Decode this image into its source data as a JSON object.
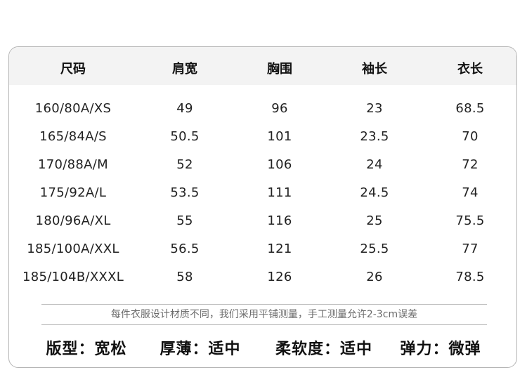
{
  "table": {
    "headers": [
      "尺码",
      "肩宽",
      "胸围",
      "袖长",
      "衣长"
    ],
    "rows": [
      [
        "160/80A/XS",
        "49",
        "96",
        "23",
        "68.5"
      ],
      [
        "165/84A/S",
        "50.5",
        "101",
        "23.5",
        "70"
      ],
      [
        "170/88A/M",
        "52",
        "106",
        "24",
        "72"
      ],
      [
        "175/92A/L",
        "53.5",
        "111",
        "24.5",
        "74"
      ],
      [
        "180/96A/XL",
        "55",
        "116",
        "25",
        "75.5"
      ],
      [
        "185/100A/XXL",
        "56.5",
        "121",
        "25.5",
        "77"
      ],
      [
        "185/104B/XXXL",
        "58",
        "126",
        "26",
        "78.5"
      ]
    ]
  },
  "note": "每件衣服设计材质不同，我们采用平铺测量，手工测量允许2-3cm误差",
  "properties": [
    "版型：宽松",
    "厚薄：适中",
    "柔软度：适中",
    "弹力：微弹"
  ]
}
